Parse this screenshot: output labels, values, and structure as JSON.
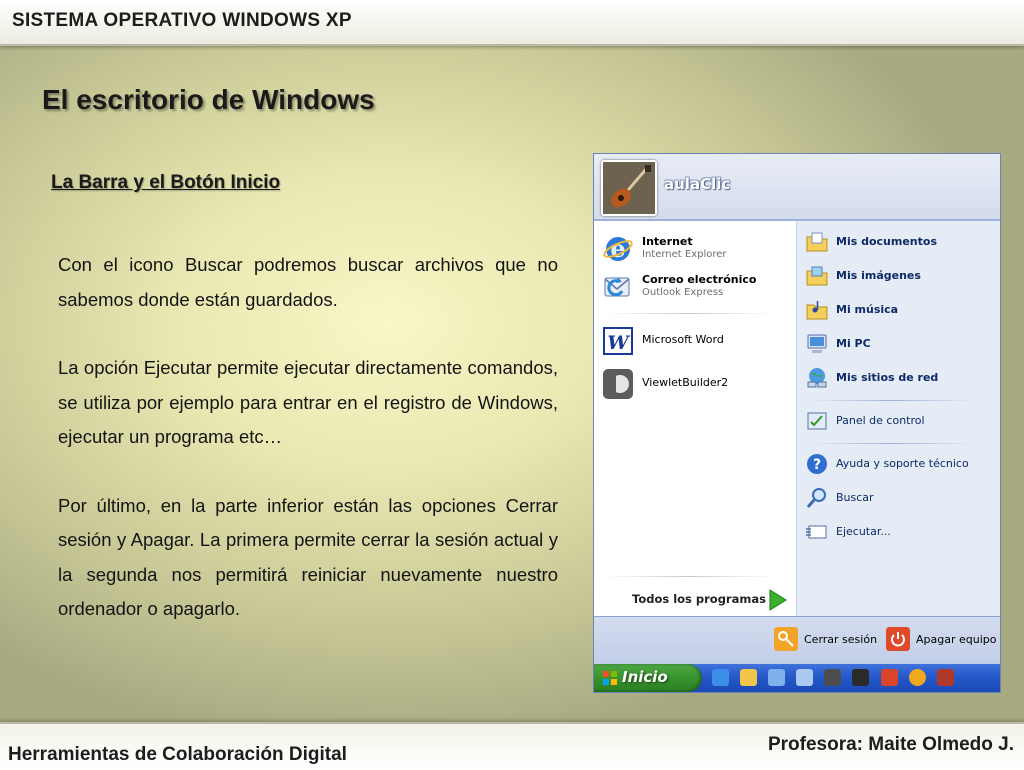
{
  "header": {
    "title": "SISTEMA OPERATIVO WINDOWS XP"
  },
  "slide": {
    "heading": "El escritorio de Windows",
    "subheading": "La Barra y el Botón Inicio",
    "paragraphs": [
      "Con el icono Buscar podremos buscar archivos que no sabemos donde están guardados.",
      "La opción Ejecutar permite ejecutar directamente comandos, se utiliza por ejemplo para entrar en el registro de Windows, ejecutar un programa etc…",
      "Por último, en la parte inferior están las opciones Cerrar sesión y Apagar. La primera permite cerrar la sesión actual y la segunda nos permitirá reiniciar nuevamente nuestro ordenador o apagarlo."
    ]
  },
  "footer": {
    "left": "Herramientas de Colaboración Digital",
    "right": "Profesora: Maite Olmedo J."
  },
  "start_menu": {
    "username": "aulaClic",
    "pinned": [
      {
        "title": "Internet",
        "subtitle": "Internet Explorer",
        "icon": "internet-explorer-icon"
      },
      {
        "title": "Correo electrónico",
        "subtitle": "Outlook Express",
        "icon": "outlook-express-icon"
      }
    ],
    "recent": [
      {
        "label": "Microsoft Word",
        "icon": "microsoft-word-icon"
      },
      {
        "label": "ViewletBuilder2",
        "icon": "viewletbuilder-icon"
      }
    ],
    "all_programs": "Todos los programas",
    "right_items": [
      {
        "label": "Mis documentos",
        "icon": "my-documents-icon"
      },
      {
        "label": "Mis imágenes",
        "icon": "my-pictures-icon"
      },
      {
        "label": "Mi música",
        "icon": "my-music-icon"
      },
      {
        "label": "Mi PC",
        "icon": "my-computer-icon"
      },
      {
        "label": "Mis sitios de red",
        "icon": "network-places-icon"
      },
      {
        "label": "Panel de control",
        "icon": "control-panel-icon"
      },
      {
        "label": "Ayuda y soporte técnico",
        "icon": "help-icon"
      },
      {
        "label": "Buscar",
        "icon": "search-icon"
      },
      {
        "label": "Ejecutar...",
        "icon": "run-icon"
      }
    ],
    "logoff": "Cerrar sesión",
    "shutdown": "Apagar equipo",
    "start_button": "Inicio"
  }
}
